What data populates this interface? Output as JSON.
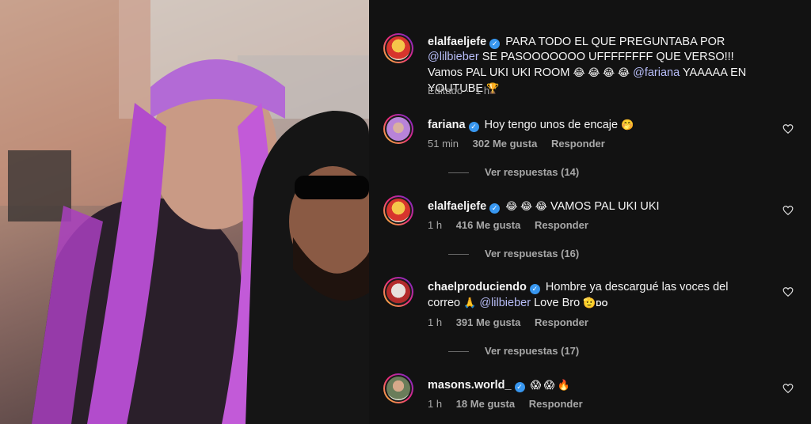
{
  "post": {
    "username": "elalfaeljefe",
    "text_1": "PARA TODO EL QUE PREGUNTABA POR",
    "mention_1": "@lilbieber",
    "text_2": "SE PASOOOOOOO UFFFFFFFF QUE VERSO!!! Vamos PAL UKI UKI ROOM",
    "emojis_1": "😂 😂 😂 😂",
    "mention_2": "@fariana",
    "text_3": "YAAAAA EN YOUTUBE",
    "emoji_trophy": "🏆",
    "edited": "Editado",
    "time": "1 h"
  },
  "comments": [
    {
      "username": "fariana",
      "text": "Hoy tengo unos de encaje",
      "emoji": "🤭",
      "time": "51 min",
      "likes": "302 Me gusta",
      "reply": "Responder",
      "view_replies": "Ver respuestas (14)"
    },
    {
      "username": "elalfaeljefe",
      "emoji": "😂 😂 😂",
      "text": "VAMOS PAL UKI UKI",
      "time": "1 h",
      "likes": "416 Me gusta",
      "reply": "Responder",
      "view_replies": "Ver respuestas (16)"
    },
    {
      "username": "chaelproduciendo",
      "text_1": "Hombre ya descargué las voces del correo",
      "emoji_1": "🙏",
      "mention": "@lilbieber",
      "text_2": "Love Bro",
      "emoji_2": "🫡",
      "text_3": "DO",
      "time": "1 h",
      "likes": "391 Me gusta",
      "reply": "Responder",
      "view_replies": "Ver respuestas (17)"
    },
    {
      "username": "masons.world_",
      "emoji": "😱 😱 🔥",
      "time": "1 h",
      "likes": "18 Me gusta",
      "reply": "Responder"
    }
  ],
  "colors": {
    "panel_bg": "#121212",
    "mention": "#b7bdf8",
    "verified": "#3897f0",
    "meta": "#a8a8a8"
  },
  "icons": [
    "verified-badge-icon",
    "heart-icon"
  ]
}
